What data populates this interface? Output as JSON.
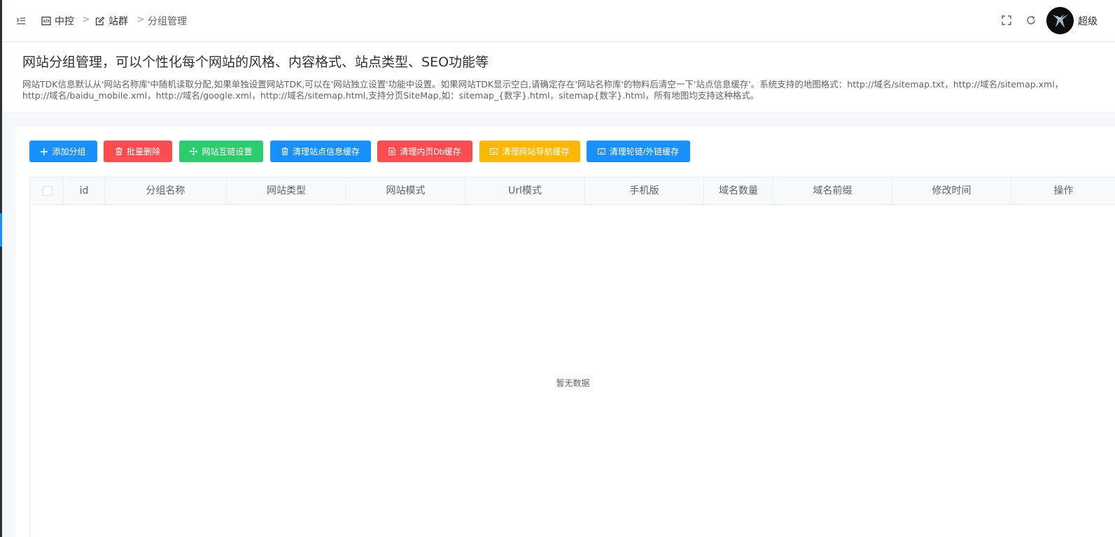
{
  "breadcrumb": {
    "items": [
      {
        "label": "中控",
        "icon": "code-icon"
      },
      {
        "label": "站群",
        "icon": "edit-icon"
      },
      {
        "label": "分组管理"
      }
    ],
    "separator": ">"
  },
  "header": {
    "username": "超级",
    "icons": [
      "fullscreen-icon",
      "refresh-icon"
    ]
  },
  "page": {
    "title": "网站分组管理，可以个性化每个网站的风格、内容格式、站点类型、SEO功能等",
    "description": "网站TDK信息默认从'网站名称库'中随机读取分配,如果单独设置网站TDK,可以在'网站独立设置'功能中设置。如果网站TDK显示空白,请确定存在'网站名称库'的物料后清空一下'站点信息缓存'。系统支持的地图格式：http://域名/sitemap.txt，http://域名/sitemap.xml，http://域名/baidu_mobile.xml，http://域名/google.xml，http://域名/sitemap.html,支持分页SiteMap,如：sitemap_{数字}.html，sitemap{数字}.html，所有地图均支持这种格式。"
  },
  "toolbar": {
    "add_group": "添加分组",
    "batch_delete": "批量删除",
    "site_links": "网站互链设置",
    "clear_site_cache": "清理站点信息缓存",
    "clear_db_cache": "清理内页Db缓存",
    "clear_nav_cache": "清理网站导航缓存",
    "clear_link_cache": "清理轮链/外链缓存"
  },
  "table": {
    "columns": [
      "id",
      "分组名称",
      "网站类型",
      "网站模式",
      "Url模式",
      "手机版",
      "域名数量",
      "域名前缀",
      "修改时间",
      "操作"
    ],
    "empty_text": "暂无数据"
  },
  "colors": {
    "primary": "#1890ff",
    "danger": "#ff4d4f",
    "success": "#2bcc6e",
    "warning": "#ffb800"
  }
}
